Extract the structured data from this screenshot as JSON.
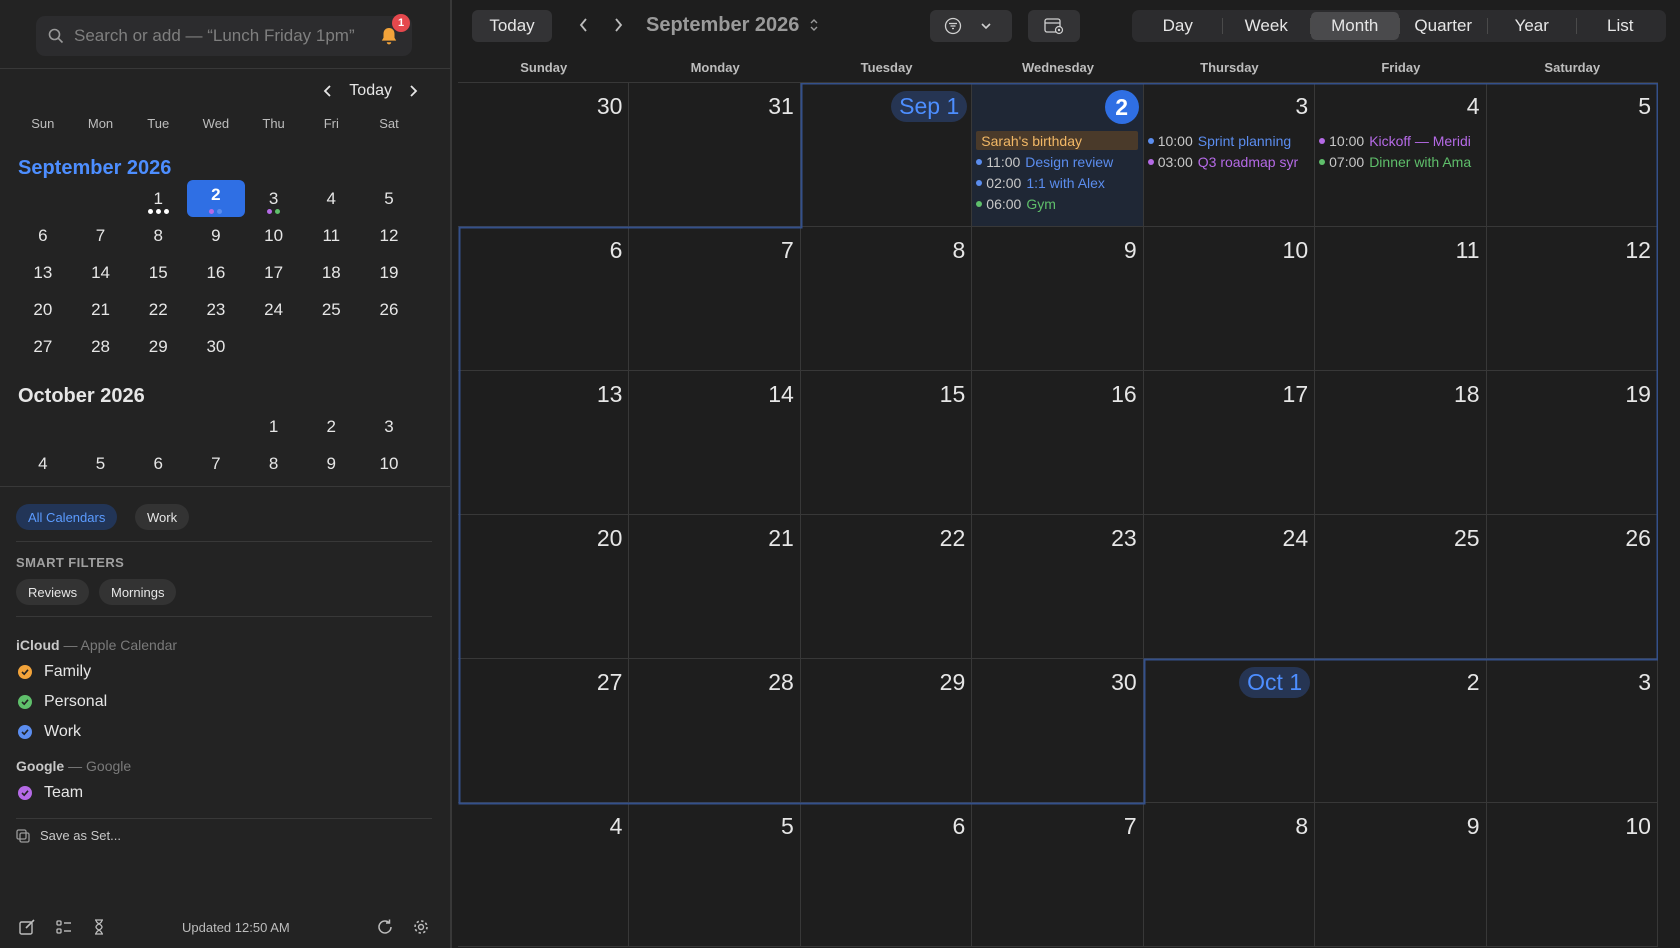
{
  "search": {
    "placeholder": "Search or add — “Lunch Friday 1pm”",
    "notification_count": "1"
  },
  "mini_nav": {
    "today_label": "Today"
  },
  "mini_dow": [
    "Sun",
    "Mon",
    "Tue",
    "Wed",
    "Thu",
    "Fri",
    "Sat"
  ],
  "mini_months": [
    {
      "label": "September 2026",
      "rows": [
        [
          "",
          "",
          "1",
          "2",
          "3",
          "4",
          "5"
        ],
        [
          "6",
          "7",
          "8",
          "9",
          "10",
          "11",
          "12"
        ],
        [
          "13",
          "14",
          "15",
          "16",
          "17",
          "18",
          "19"
        ],
        [
          "20",
          "21",
          "22",
          "23",
          "24",
          "25",
          "26"
        ],
        [
          "27",
          "28",
          "29",
          "30",
          "",
          "",
          ""
        ]
      ]
    },
    {
      "label": "October 2026",
      "rows": [
        [
          "",
          "",
          "",
          "",
          "1",
          "2",
          "3"
        ],
        [
          "4",
          "5",
          "6",
          "7",
          "8",
          "9",
          "10"
        ]
      ]
    }
  ],
  "calendar_sets": {
    "all": "All Calendars",
    "work": "Work"
  },
  "smart_filters": {
    "heading": "SMART FILTERS",
    "items": [
      "Reviews",
      "Mornings"
    ]
  },
  "sources": [
    {
      "name": "iCloud",
      "sub": "— Apple Calendar",
      "calendars": [
        {
          "name": "Family",
          "color": "#f2a33a"
        },
        {
          "name": "Personal",
          "color": "#5fbf6b"
        },
        {
          "name": "Work",
          "color": "#5b8def"
        }
      ]
    },
    {
      "name": "Google",
      "sub": "— Google",
      "calendars": [
        {
          "name": "Team",
          "color": "#b56ae6"
        }
      ]
    }
  ],
  "save_set_label": "Save as Set...",
  "footer": {
    "updated": "Updated 12:50 AM"
  },
  "toolbar": {
    "today_label": "Today",
    "title": "September 2026",
    "views": [
      "Day",
      "Week",
      "Month",
      "Quarter",
      "Year",
      "List"
    ],
    "active_view": "Month"
  },
  "week_days": [
    "Sunday",
    "Monday",
    "Tuesday",
    "Wednesday",
    "Thursday",
    "Friday",
    "Saturday"
  ],
  "weeks": [
    [
      "30",
      "31",
      "Sep 1",
      "2",
      "3",
      "4",
      "5"
    ],
    [
      "6",
      "7",
      "8",
      "9",
      "10",
      "11",
      "12"
    ],
    [
      "13",
      "14",
      "15",
      "16",
      "17",
      "18",
      "19"
    ],
    [
      "20",
      "21",
      "22",
      "23",
      "24",
      "25",
      "26"
    ],
    [
      "27",
      "28",
      "29",
      "30",
      "Oct 1",
      "2",
      "3"
    ],
    [
      "4",
      "5",
      "6",
      "7",
      "8",
      "9",
      "10"
    ]
  ],
  "events": {
    "wed": [
      {
        "allday": true,
        "title": "Sarah's birthday"
      },
      {
        "time": "11:00",
        "title": "Design review",
        "color": "#5b8def"
      },
      {
        "time": "02:00",
        "title": "1:1 with Alex",
        "color": "#5b8def"
      },
      {
        "time": "06:00",
        "title": "Gym",
        "color": "#5fbf6b"
      }
    ],
    "thu": [
      {
        "time": "10:00",
        "title": "Sprint planning",
        "color": "#5b8def"
      },
      {
        "time": "03:00",
        "title": "Q3 roadmap syr",
        "color": "#b56ae6"
      }
    ],
    "fri": [
      {
        "time": "10:00",
        "title": "Kickoff — Meridi",
        "color": "#b56ae6"
      },
      {
        "time": "07:00",
        "title": "Dinner with Ama",
        "color": "#5fbf6b"
      }
    ]
  },
  "colors": {
    "accent": "#2f6fe4",
    "work": "#5b8def",
    "team": "#b56ae6",
    "personal": "#5fbf6b",
    "family": "#f2a33a"
  }
}
